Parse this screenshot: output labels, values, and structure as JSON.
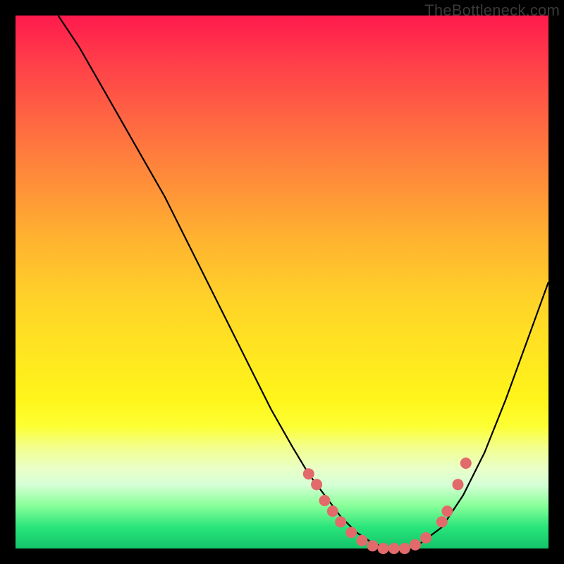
{
  "watermark": "TheBottleneck.com",
  "colors": {
    "dot": "#e36a6a",
    "curve": "#000000",
    "frame_bg_top": "#ff1a4d",
    "frame_bg_bottom": "#13c46a",
    "page_bg": "#000000"
  },
  "chart_data": {
    "type": "line",
    "title": "",
    "xlabel": "",
    "ylabel": "",
    "xlim": [
      0,
      100
    ],
    "ylim": [
      0,
      100
    ],
    "series": [
      {
        "name": "bottleneck-curve",
        "x": [
          8,
          12,
          16,
          20,
          24,
          28,
          32,
          36,
          40,
          44,
          48,
          52,
          55,
          58,
          61,
          64,
          67,
          70,
          73,
          76,
          80,
          84,
          88,
          92,
          96,
          100
        ],
        "y": [
          100,
          94,
          87,
          80,
          73,
          66,
          58,
          50,
          42,
          34,
          26,
          19,
          14,
          10,
          6,
          3,
          1,
          0,
          0,
          1,
          4,
          10,
          18,
          28,
          39,
          50
        ]
      }
    ],
    "points": {
      "name": "highlight-dots",
      "x": [
        55,
        56.5,
        58,
        59.5,
        61,
        63,
        65,
        67,
        69,
        71,
        73,
        75,
        77,
        80,
        81,
        83,
        84.5
      ],
      "y": [
        14,
        12,
        9,
        7,
        5,
        3,
        1.5,
        0.5,
        0,
        0,
        0,
        0.7,
        2,
        5,
        7,
        12,
        16
      ]
    }
  }
}
